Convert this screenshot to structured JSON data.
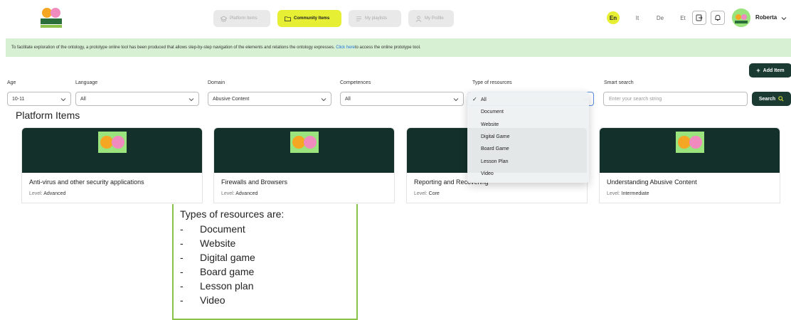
{
  "header": {
    "nav": [
      {
        "label": "Platform Items",
        "icon": "graduation-cap-icon",
        "active": false
      },
      {
        "label": "Community Items",
        "icon": "folder-icon",
        "active": true
      },
      {
        "label": "My playlists",
        "icon": "playlist-icon",
        "active": false
      },
      {
        "label": "My Profile",
        "icon": "user-icon",
        "active": false
      }
    ],
    "languages": [
      "En",
      "It",
      "De",
      "Et"
    ],
    "user_name": "Roberta"
  },
  "banner": {
    "text": "To facilitate exploration of the ontology, a prototype online tool has been produced that allows step-by-step navigation of the elements and relations the ontology expresses. ",
    "link": "Click here",
    "after_link": " to access the online prototype tool."
  },
  "add_item_label": "Add Item",
  "filters": {
    "age": {
      "label": "Age",
      "value": "10-11"
    },
    "language": {
      "label": "Language",
      "value": "All"
    },
    "domain": {
      "label": "Domain",
      "value": "Abusive Content"
    },
    "competences": {
      "label": "Competences",
      "value": "All"
    },
    "type": {
      "label": "Type of resources",
      "value": "All"
    },
    "smart_search": {
      "label": "Smart search",
      "placeholder": "Enter your search string"
    },
    "search_button": "Search"
  },
  "section_title": "Platform Items",
  "cards": [
    {
      "title": "Anti-virus and other security applications",
      "level_label": "Level:",
      "level": "Advanced",
      "logo_text": "SUPER CYBER KIDS"
    },
    {
      "title": "Firewalls and Browsers",
      "level_label": "Level:",
      "level": "Advanced",
      "logo_text": "SUPER CYBER KIDS"
    },
    {
      "title": "Reporting and Recovering",
      "level_label": "Level:",
      "level": "Core",
      "logo_text": ""
    },
    {
      "title": "Understanding Abusive Content",
      "level_label": "Level:",
      "level": "Intermediate",
      "logo_text": "SUPER CYBER KIDS"
    }
  ],
  "dropdown": {
    "options": [
      "All",
      "Document",
      "Website",
      "Digital Game",
      "Board Game",
      "Lesson Plan",
      "Video"
    ],
    "selected": "All"
  },
  "note": {
    "title": "Types of resources are:",
    "items": [
      "Document",
      "Website",
      "Digital game",
      "Board game",
      "Lesson plan",
      "Video"
    ]
  },
  "colors": {
    "accent": "#e6ef33",
    "dark": "#14302a",
    "banner": "#d7f0d3",
    "link": "#1f73d8",
    "note_border": "#8bc34a"
  }
}
